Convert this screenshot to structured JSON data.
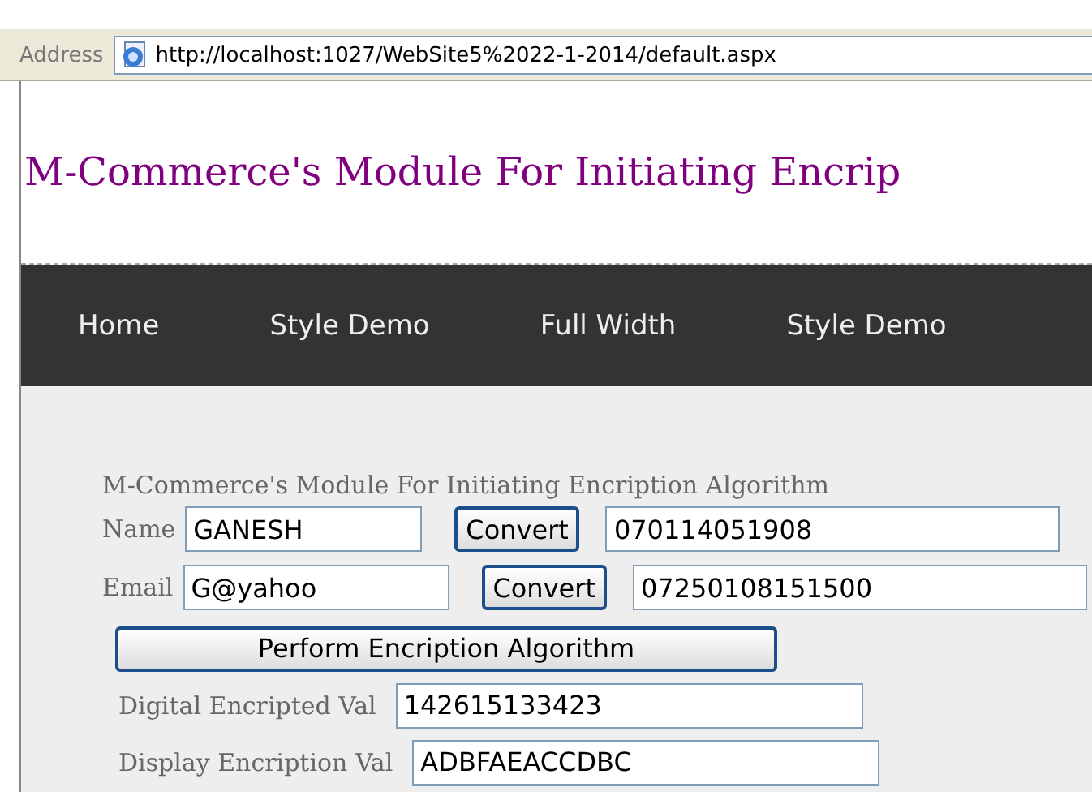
{
  "address_bar": {
    "label": "Address",
    "url": "http://localhost:1027/WebSite5%2022-1-2014/default.aspx"
  },
  "site_title": "M-Commerce's Module For Initiating Encrip",
  "nav": [
    "Home",
    "Style Demo",
    "Full Width",
    "Style Demo"
  ],
  "form": {
    "heading": "M-Commerce's Module For Initiating Encription Algorithm",
    "rows": [
      {
        "label": "Name",
        "value": "GANESH",
        "button": "Convert",
        "result": "070114051908"
      },
      {
        "label": "Email",
        "value": "G@yahoo",
        "button": "Convert",
        "result": "07250108151500"
      }
    ],
    "perform_button": "Perform Encription Algorithm",
    "outputs": [
      {
        "label": "Digital Encripted Val",
        "value": "142615133423"
      },
      {
        "label": "Display Encription Val",
        "value": "ADBFAEACCDBC"
      }
    ]
  }
}
